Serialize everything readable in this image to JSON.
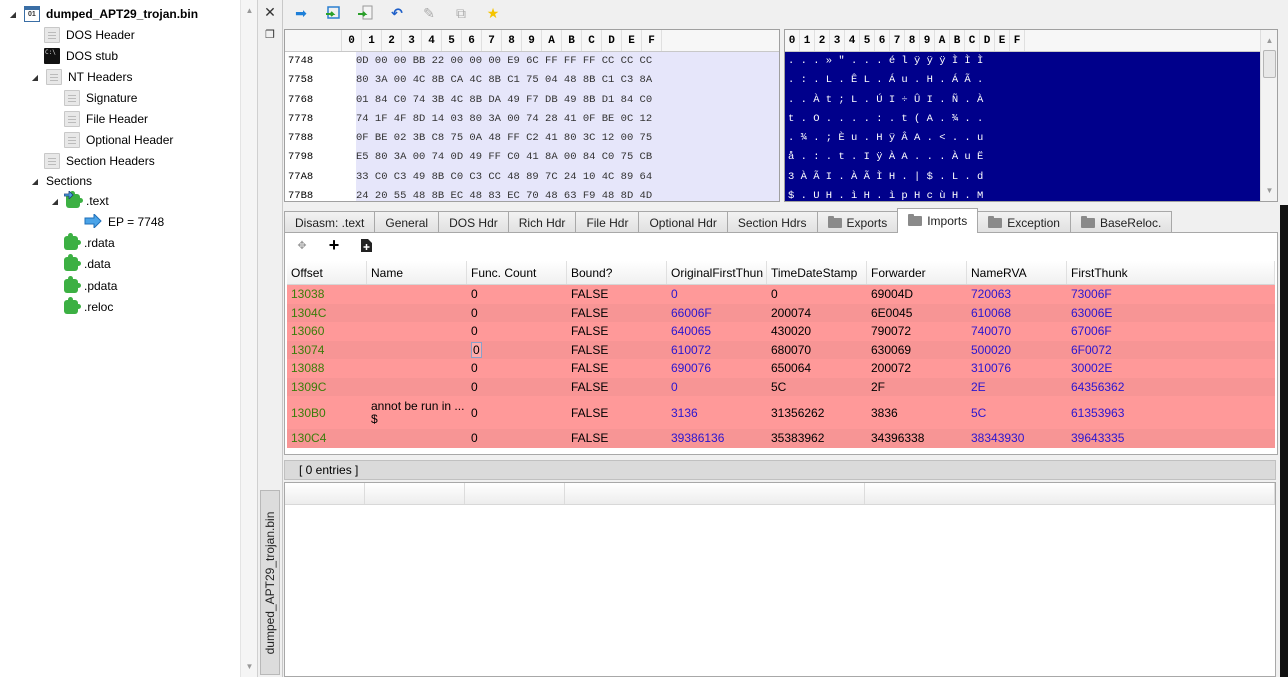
{
  "tree": {
    "root": "dumped_APT29_trojan.bin",
    "items": [
      {
        "label": "DOS Header",
        "icon": "file-icon"
      },
      {
        "label": "DOS stub",
        "icon": "terminal-icon"
      },
      {
        "label": "NT Headers",
        "icon": "file-icon"
      },
      {
        "label": "Signature",
        "icon": "file-icon"
      },
      {
        "label": "File Header",
        "icon": "file-icon"
      },
      {
        "label": "Optional Header",
        "icon": "file-icon"
      },
      {
        "label": "Section Headers",
        "icon": "file-icon"
      },
      {
        "label": "Sections",
        "icon": ""
      },
      {
        "label": ".text",
        "icon": "puzzle-icon"
      },
      {
        "label": "EP = 7748",
        "icon": "arrow-right-icon"
      },
      {
        "label": ".rdata",
        "icon": "puzzle-icon"
      },
      {
        "label": ".data",
        "icon": "puzzle-icon"
      },
      {
        "label": ".pdata",
        "icon": "puzzle-icon"
      },
      {
        "label": ".reloc",
        "icon": "puzzle-icon"
      }
    ]
  },
  "vertical_tab": "dumped_APT29_trojan.bin",
  "toolbar": {
    "icons": [
      "go-to-arrow-icon",
      "import-icon",
      "export-icon",
      "undo-icon",
      "pin-icon",
      "copy-icon",
      "star-icon"
    ]
  },
  "hex": {
    "columns": [
      "0",
      "1",
      "2",
      "3",
      "4",
      "5",
      "6",
      "7",
      "8",
      "9",
      "A",
      "B",
      "C",
      "D",
      "E",
      "F"
    ],
    "rows": [
      {
        "addr": "7748",
        "bytes": "0D 00 00 BB 22 00 00 00 E9 6C FF FF FF CC CC CC",
        "ascii": ". . . » \" . . . é l ÿ ÿ ÿ Ì Ì Ì"
      },
      {
        "addr": "7758",
        "bytes": "80 3A 00 4C 8B CA 4C 8B C1 75 04 48 8B C1 C3 8A",
        "ascii": ". : . L . Ê L . Á u . H . Á Ã ."
      },
      {
        "addr": "7768",
        "bytes": "01 84 C0 74 3B 4C 8B DA 49 F7 DB 49 8B D1 84 C0",
        "ascii": ". . À t ; L . Ú I ÷ Û I . Ñ . À"
      },
      {
        "addr": "7778",
        "bytes": "74 1F 4F 8D 14 03 80 3A 00 74 28 41 0F BE 0C 12",
        "ascii": "t . O . . . . : . t ( A . ¾ . ."
      },
      {
        "addr": "7788",
        "bytes": "0F BE 02 3B C8 75 0A 48 FF C2 41 80 3C 12 00 75",
        "ascii": ". ¾ . ; È u . H ÿ Â A . < . . u"
      },
      {
        "addr": "7798",
        "bytes": "E5 80 3A 00 74 0D 49 FF C0 41 8A 00 84 C0 75 CB",
        "ascii": "å . : . t . I ÿ À A . . . À u Ë"
      },
      {
        "addr": "77A8",
        "bytes": "33 C0 C3 49 8B C0 C3 CC 48 89 7C 24 10 4C 89 64",
        "ascii": "3 À Ã I . À Ã Ì H . | $ . L . d"
      },
      {
        "addr": "77B8",
        "bytes": "24 20 55 48 8B EC 48 83 EC 70 48 63 F9 48 8D 4D",
        "ascii": "$ . U H . ì H . ì p H c ù H . M"
      }
    ]
  },
  "tabs": [
    {
      "label": "Disasm: .text",
      "folder": false
    },
    {
      "label": "General",
      "folder": false
    },
    {
      "label": "DOS Hdr",
      "folder": false
    },
    {
      "label": "Rich Hdr",
      "folder": false
    },
    {
      "label": "File Hdr",
      "folder": false
    },
    {
      "label": "Optional Hdr",
      "folder": false
    },
    {
      "label": "Section Hdrs",
      "folder": false
    },
    {
      "label": "Exports",
      "folder": true
    },
    {
      "label": "Imports",
      "folder": true,
      "active": true
    },
    {
      "label": "Exception",
      "folder": true
    },
    {
      "label": "BaseReloc.",
      "folder": true
    }
  ],
  "panel_tools": [
    "move-icon",
    "add-icon",
    "add-file-icon"
  ],
  "imports": {
    "columns": [
      "Offset",
      "Name",
      "Func. Count",
      "Bound?",
      "OriginalFirstThun",
      "TimeDateStamp",
      "Forwarder",
      "NameRVA",
      "FirstThunk"
    ],
    "rows": [
      [
        "13038",
        "",
        "0",
        "FALSE",
        "0",
        "0",
        "69004D",
        "720063",
        "73006F"
      ],
      [
        "1304C",
        "",
        "0",
        "FALSE",
        "66006F",
        "200074",
        "6E0045",
        "610068",
        "63006E"
      ],
      [
        "13060",
        "",
        "0",
        "FALSE",
        "640065",
        "430020",
        "790072",
        "740070",
        "67006F"
      ],
      [
        "13074",
        "",
        "0",
        "FALSE",
        "610072",
        "680070",
        "630069",
        "500020",
        "6F0072"
      ],
      [
        "13088",
        "",
        "0",
        "FALSE",
        "690076",
        "650064",
        "200072",
        "310076",
        "30002E"
      ],
      [
        "1309C",
        "",
        "0",
        "FALSE",
        "0",
        "5C",
        "2F",
        "2E",
        "64356362"
      ],
      [
        "130B0",
        "annot be run in ... $",
        "0",
        "FALSE",
        "3136",
        "31356262",
        "3836",
        "5C",
        "61353963"
      ],
      [
        "130C4",
        "",
        "0",
        "FALSE",
        "39386136",
        "35383962",
        "34396338",
        "38343930",
        "39643335"
      ]
    ],
    "row_color": "#ff9999",
    "offset_color": "#3a7d0a",
    "link_color": "#2a16d0"
  },
  "entries_label": "[ 0 entries ]"
}
